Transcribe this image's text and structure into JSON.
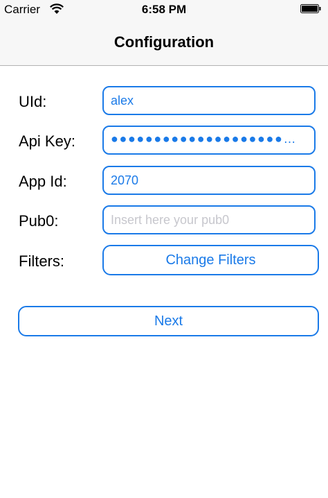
{
  "status_bar": {
    "carrier": "Carrier",
    "time": "6:58 PM",
    "wifi_icon": "wifi-icon",
    "battery_icon": "battery-icon",
    "battery_level": 1.0
  },
  "nav": {
    "title": "Configuration"
  },
  "form": {
    "uid_label": "UId:",
    "uid_value": "alex",
    "api_key_label": "Api Key:",
    "api_key_display": "●●●●●●●●●●●●●●●●●●●●…",
    "app_id_label": "App Id:",
    "app_id_value": "2070",
    "pub0_label": "Pub0:",
    "pub0_placeholder": "Insert here your pub0",
    "filters_label": "Filters:",
    "change_filters_button": "Change Filters"
  },
  "next_button": "Next",
  "colors": {
    "accent": "#1a7ae8",
    "bar_background": "#f7f7f7",
    "placeholder": "#c7c7cd"
  }
}
